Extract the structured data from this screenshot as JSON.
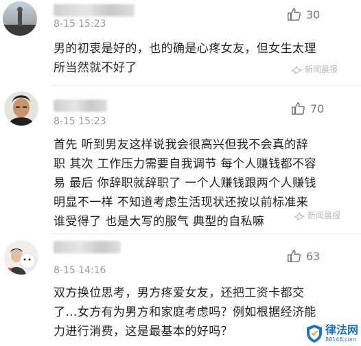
{
  "comments": [
    {
      "time": "8-15 15:23",
      "likes": "30",
      "lines": [
        "男的初衷是好的，也的确是心疼女友，但女生太理",
        "所当然就不好了"
      ],
      "watermark": "新闻晨报"
    },
    {
      "time": "8-15 15:23",
      "likes": "70",
      "lines": [
        "首先 听到男友这样说我会很高兴但我不会真的辞",
        "职 其次 工作压力需要自我调节 每个人赚钱都不容",
        "易 最后 你辞职就辞职了 一个人赚钱跟两个人赚钱",
        "明显不一样 不知道考虑生活现状还按以前标准来",
        "谁受得了 也是大写的服气 典型的自私嘛"
      ],
      "watermark": "新闻晨报"
    },
    {
      "time": "8-15 14:16",
      "likes": "63",
      "lines": [
        "双方换位思考，男方疼爱女友，还把工资卡都交",
        "了…女方有为男方和家庭考虑吗？例如根据经济能",
        "力进行消费，这是最基本的好吗？"
      ]
    }
  ],
  "site_logo": {
    "name": "律法网",
    "url": "88148.com"
  },
  "colors": {
    "text": "#222222",
    "meta": "#9a9a9a",
    "logo_blue": "#1a73c8"
  }
}
